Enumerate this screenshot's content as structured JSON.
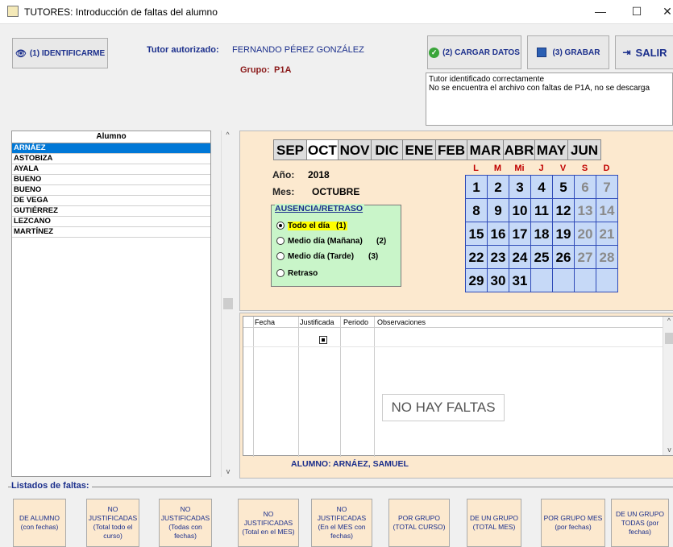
{
  "window": {
    "title": "TUTORES: Introducción de faltas del alumno",
    "minimize": "—",
    "maximize": "☐",
    "close": "✕"
  },
  "toolbar": {
    "identify_label": "(1) IDENTIFICARME",
    "load_label": "(2) CARGAR DATOS",
    "save_label": "(3) GRABAR",
    "exit_label": "SALIR"
  },
  "tutor": {
    "caption": "Tutor autorizado:",
    "name": "FERNANDO PÉREZ GONZÁLEZ",
    "group_caption": "Grupo:",
    "group": "P1A"
  },
  "messages": {
    "line1": "Tutor identificado correctamente",
    "line2": "No se encuentra el archivo con faltas de P1A, no se descarga"
  },
  "students": {
    "header": "Alumno",
    "items": [
      "ARNÁEZ",
      "ASTOBIZA",
      "AYALA",
      "BUENO",
      "BUENO",
      "DE VEGA",
      "GUTIÉRREZ",
      "LEZCANO",
      "MARTÍNEZ"
    ]
  },
  "calendar": {
    "months": [
      "SEP",
      "OCT",
      "NOV",
      "DIC",
      "ENE",
      "FEB",
      "MAR",
      "ABR",
      "MAY",
      "JUN"
    ],
    "selected_month": "OCT",
    "year_label": "Año:",
    "year": "2018",
    "month_label": "Mes:",
    "month": "OCTUBRE",
    "weekdays": [
      "L",
      "M",
      "Mi",
      "J",
      "V",
      "S",
      "D"
    ],
    "weeks": [
      [
        "1",
        "2",
        "3",
        "4",
        "5",
        "6",
        "7"
      ],
      [
        "8",
        "9",
        "10",
        "11",
        "12",
        "13",
        "14"
      ],
      [
        "15",
        "16",
        "17",
        "18",
        "19",
        "20",
        "21"
      ],
      [
        "22",
        "23",
        "24",
        "25",
        "26",
        "27",
        "28"
      ],
      [
        "29",
        "30",
        "31",
        "",
        "",
        "",
        ""
      ]
    ]
  },
  "absence": {
    "title": "AUSENCIA/RETRASO",
    "options": [
      {
        "label": "Todo el día",
        "code": "(1)",
        "selected": true
      },
      {
        "label": "Medio día (Mañana)",
        "code": "(2)",
        "selected": false
      },
      {
        "label": "Medio día (Tarde)",
        "code": "(3)",
        "selected": false
      },
      {
        "label": "Retraso",
        "code": "",
        "selected": false
      }
    ]
  },
  "grid": {
    "columns": [
      "Fecha",
      "Justificada",
      "Periodo",
      "Observaciones"
    ],
    "empty_message": "NO HAY FALTAS"
  },
  "current_student": {
    "caption": "ALUMNO:",
    "name": "ARNÁEZ, SAMUEL"
  },
  "listados": {
    "title": "Listados de faltas:",
    "buttons": [
      "DE ALUMNO (con fechas)",
      "NO JUSTIFICADAS (Total todo el curso)",
      "NO JUSTIFICADAS (Todas con fechas)",
      "NO JUSTIFICADAS (Total en el MES)",
      "NO JUSTIFICADAS (En el MES con fechas)",
      "POR GRUPO (TOTAL CURSO)",
      "DE UN GRUPO (TOTAL MES)",
      "POR GRUPO MES (por fechas)",
      "DE UN GRUPO TODAS (por fechas)"
    ]
  },
  "colors": {
    "accent_blue": "#1b2f8c",
    "panel_peach": "#fce9cf",
    "day_blue": "#c6d9f7",
    "absence_green": "#c9f5c9",
    "selected_row": "#0078d7",
    "highlight_yellow": "#ffff00"
  }
}
